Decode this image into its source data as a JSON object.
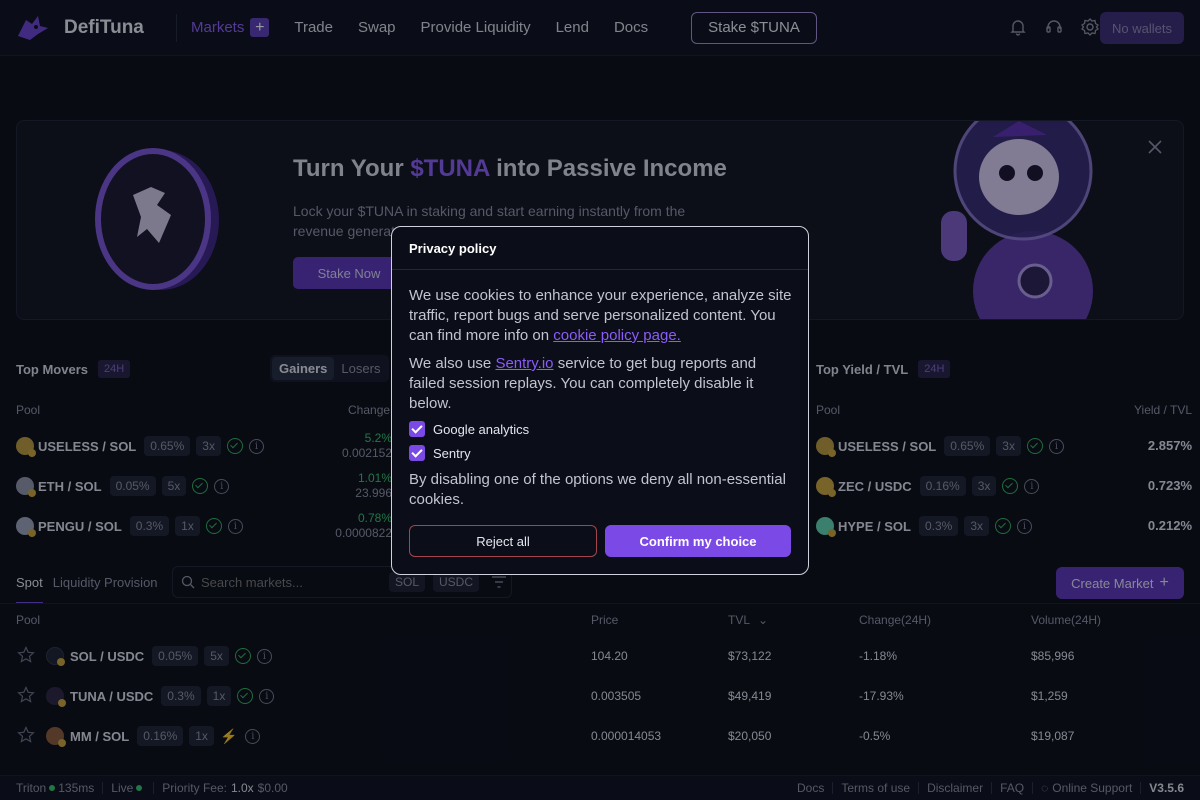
{
  "header": {
    "logo_text": "DefiTuna",
    "nav": [
      {
        "label": "Markets"
      },
      {
        "label": "Trade"
      },
      {
        "label": "Swap"
      },
      {
        "label": "Provide Liquidity"
      },
      {
        "label": "Lend"
      },
      {
        "label": "Docs"
      }
    ],
    "plus": "+",
    "stake_label": "Stake $TUNA",
    "wallet_label": "No wallets",
    "icons": [
      "bell-icon",
      "support-icon",
      "settings-icon"
    ]
  },
  "banner": {
    "title_pre": "Turn Your ",
    "title_hl": "$TUNA",
    "title_post": " into Passive Income",
    "subtitle": "Lock your $TUNA in staking and start earning instantly from the revenue generated by the protocol.",
    "button": "Stake Now",
    "close": "×"
  },
  "top_movers": {
    "title": "Top Movers",
    "badge": "24H",
    "toggle": [
      "Gainers",
      "Losers"
    ],
    "col_pool": "Pool",
    "col_change": "Change",
    "rows": [
      {
        "pool": "USELESS / SOL",
        "fee": "0.65%",
        "lev": "3x",
        "change": "5.2%",
        "price": "0.002152"
      },
      {
        "pool": "ETH / SOL",
        "fee": "0.05%",
        "lev": "5x",
        "change": "1.01%",
        "price": "23.996"
      },
      {
        "pool": "PENGU / SOL",
        "fee": "0.3%",
        "lev": "1x",
        "change": "0.78%",
        "price": "0.0000822"
      }
    ]
  },
  "top_yield": {
    "title": "Top Yield / TVL",
    "badge": "24H",
    "col_pool": "Pool",
    "col_value": "Yield / TVL",
    "rows": [
      {
        "pool": "USELESS / SOL",
        "fee": "0.65%",
        "lev": "3x",
        "value": "2.857%"
      },
      {
        "pool": "ZEC / USDC",
        "fee": "0.16%",
        "lev": "3x",
        "value": "0.723%"
      },
      {
        "pool": "HYPE / SOL",
        "fee": "0.3%",
        "lev": "3x",
        "value": "0.212%"
      }
    ]
  },
  "markets": {
    "tabs": [
      "Spot",
      "Liquidity Provision"
    ],
    "search_placeholder": "Search markets...",
    "filters": [
      "SOL",
      "USDC"
    ],
    "create_label": "Create Market",
    "columns": {
      "pool": "Pool",
      "price": "Price",
      "tvl": "TVL",
      "change": "Change(24H)",
      "volume": "Volume(24H)"
    },
    "rows": [
      {
        "pool": "SOL / USDC",
        "fee": "0.05%",
        "lev": "5x",
        "price": "104.20",
        "tvl": "$73,122",
        "change": "-1.18%",
        "volume": "$85,996"
      },
      {
        "pool": "TUNA / USDC",
        "fee": "0.3%",
        "lev": "1x",
        "price": "0.003505",
        "tvl": "$49,419",
        "change": "-17.93%",
        "volume": "$1,259"
      },
      {
        "pool": "MM / SOL",
        "fee": "0.16%",
        "lev": "1x",
        "price": "0.000014053",
        "tvl": "$20,050",
        "change": "-0.5%",
        "volume": "$19,087"
      }
    ]
  },
  "footer": {
    "provider": "Triton",
    "latency": "135ms",
    "live": "Live",
    "fee_label": "Priority Fee:",
    "fee_mult": "1.0x",
    "fee_amount": "$0.00",
    "links": [
      "Docs",
      "Terms of use",
      "Disclaimer",
      "FAQ"
    ],
    "support": "Online Support",
    "version": "V3.5.6"
  },
  "modal": {
    "title": "Privacy policy",
    "p1": "We use cookies to enhance your experience, analyze site traffic, report bugs and serve personalized content. You can find more info on ",
    "p1_link": "cookie policy page.",
    "p2_pre": "We also use ",
    "p2_link": "Sentry.io",
    "p2_post": " service to get bug reports and failed session replays. You can completely disable it below.",
    "options": [
      "Google analytics",
      "Sentry"
    ],
    "p3": "By disabling one of the options we deny all non-essential cookies.",
    "reject": "Reject all",
    "confirm": "Confirm my choice"
  },
  "colors": {
    "accent": "#7b4ae6",
    "positive": "#35c26a",
    "negative": "#d1444d",
    "background": "#090b14"
  }
}
